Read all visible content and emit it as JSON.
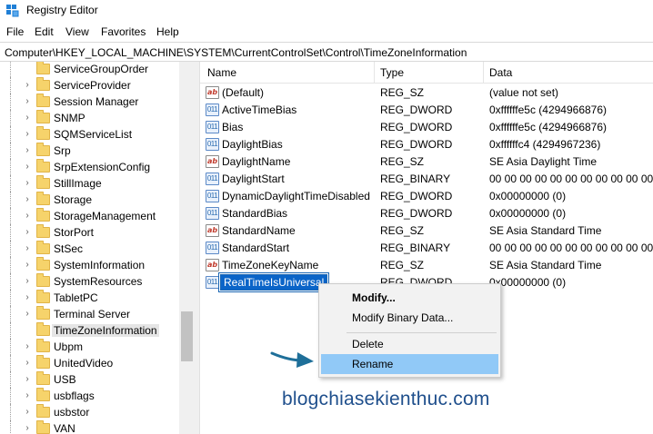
{
  "window": {
    "title": "Registry Editor",
    "icon": "registry-editor-icon"
  },
  "menu": [
    "File",
    "Edit",
    "View",
    "Favorites",
    "Help"
  ],
  "address": "Computer\\HKEY_LOCAL_MACHINE\\SYSTEM\\CurrentControlSet\\Control\\TimeZoneInformation",
  "tree": {
    "items": [
      {
        "label": "ServiceGroupOrder",
        "expandable": false
      },
      {
        "label": "ServiceProvider",
        "expandable": true
      },
      {
        "label": "Session Manager",
        "expandable": true
      },
      {
        "label": "SNMP",
        "expandable": true
      },
      {
        "label": "SQMServiceList",
        "expandable": true
      },
      {
        "label": "Srp",
        "expandable": true
      },
      {
        "label": "SrpExtensionConfig",
        "expandable": true
      },
      {
        "label": "StillImage",
        "expandable": true
      },
      {
        "label": "Storage",
        "expandable": true
      },
      {
        "label": "StorageManagement",
        "expandable": true
      },
      {
        "label": "StorPort",
        "expandable": true
      },
      {
        "label": "StSec",
        "expandable": true
      },
      {
        "label": "SystemInformation",
        "expandable": true
      },
      {
        "label": "SystemResources",
        "expandable": true
      },
      {
        "label": "TabletPC",
        "expandable": true
      },
      {
        "label": "Terminal Server",
        "expandable": true
      },
      {
        "label": "TimeZoneInformation",
        "expandable": false,
        "selected": true
      },
      {
        "label": "Ubpm",
        "expandable": true
      },
      {
        "label": "UnitedVideo",
        "expandable": true
      },
      {
        "label": "USB",
        "expandable": true
      },
      {
        "label": "usbflags",
        "expandable": true
      },
      {
        "label": "usbstor",
        "expandable": true
      },
      {
        "label": "VAN",
        "expandable": true
      }
    ]
  },
  "list": {
    "columns": {
      "name": "Name",
      "type": "Type",
      "data": "Data"
    },
    "rows": [
      {
        "name": "(Default)",
        "type": "REG_SZ",
        "data": "(value not set)",
        "icon": "string-value-icon"
      },
      {
        "name": "ActiveTimeBias",
        "type": "REG_DWORD",
        "data": "0xffffffe5c (4294966876)",
        "icon": "binary-value-icon"
      },
      {
        "name": "Bias",
        "type": "REG_DWORD",
        "data": "0xffffffe5c (4294966876)",
        "icon": "binary-value-icon"
      },
      {
        "name": "DaylightBias",
        "type": "REG_DWORD",
        "data": "0xffffffc4 (4294967236)",
        "icon": "binary-value-icon"
      },
      {
        "name": "DaylightName",
        "type": "REG_SZ",
        "data": "SE Asia Daylight Time",
        "icon": "string-value-icon"
      },
      {
        "name": "DaylightStart",
        "type": "REG_BINARY",
        "data": "00 00 00 00 00 00 00 00 00 00 00 00 00 00 00 00",
        "icon": "binary-value-icon"
      },
      {
        "name": "DynamicDaylightTimeDisabled",
        "type": "REG_DWORD",
        "data": "0x00000000 (0)",
        "icon": "binary-value-icon"
      },
      {
        "name": "StandardBias",
        "type": "REG_DWORD",
        "data": "0x00000000 (0)",
        "icon": "binary-value-icon"
      },
      {
        "name": "StandardName",
        "type": "REG_SZ",
        "data": "SE Asia Standard Time",
        "icon": "string-value-icon"
      },
      {
        "name": "StandardStart",
        "type": "REG_BINARY",
        "data": "00 00 00 00 00 00 00 00 00 00 00 00 00 00 00 00",
        "icon": "binary-value-icon"
      },
      {
        "name": "TimeZoneKeyName",
        "type": "REG_SZ",
        "data": "SE Asia Standard Time",
        "icon": "string-value-icon"
      },
      {
        "name": "RealTimeIsUniversal",
        "type": "REG_DWORD",
        "data": "0x00000000 (0)",
        "icon": "binary-value-icon",
        "editing": true
      }
    ]
  },
  "context_menu": {
    "items": [
      {
        "label": "Modify...",
        "bold": true
      },
      {
        "label": "Modify Binary Data..."
      },
      {
        "label": "Delete"
      },
      {
        "label": "Rename",
        "highlighted": true
      }
    ]
  },
  "watermark": "blogchiasekienthuc.com",
  "colors": {
    "selection": "#0a64c8",
    "menu_highlight": "#91c9f7",
    "folder": "#f6d36b",
    "arrow": "#1e6f99",
    "watermark": "#1f4f8c"
  }
}
